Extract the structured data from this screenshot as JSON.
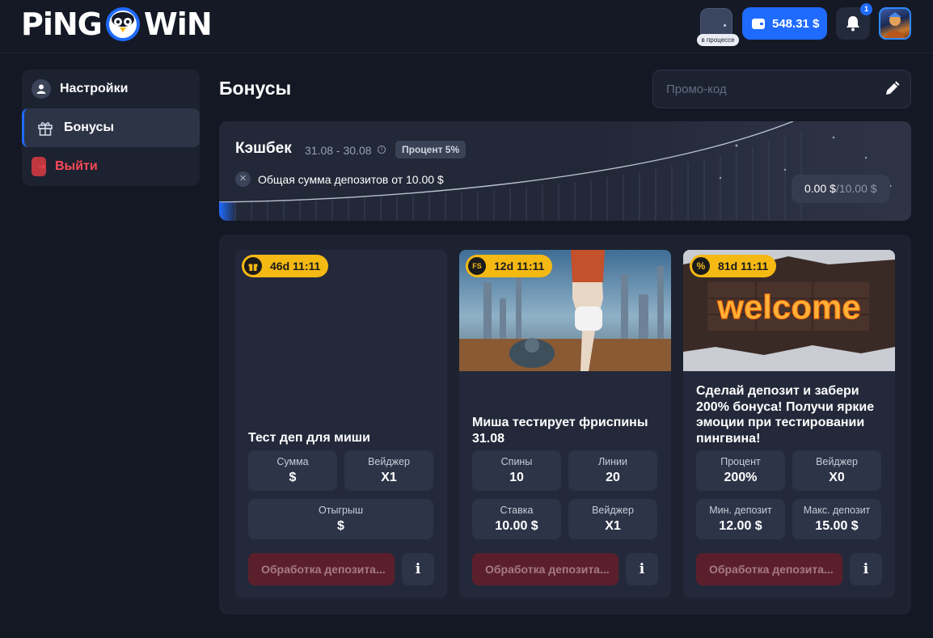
{
  "header": {
    "logo_left": "PiNG",
    "logo_right": "WiN",
    "status_label": "в процессе",
    "balance": "548.31 $",
    "notifications_count": "1"
  },
  "sidebar": {
    "items": [
      {
        "label": "Настройки",
        "icon": "user-icon"
      },
      {
        "label": "Бонусы",
        "icon": "gift-icon",
        "active": true
      },
      {
        "label": "Выйти",
        "icon": "logout-icon"
      }
    ]
  },
  "page": {
    "title": "Бонусы",
    "promo_placeholder": "Промо-код"
  },
  "cashback": {
    "title": "Кэшбек",
    "dates": "31.08 - 30.08",
    "badge": "Процент 5%",
    "condition": "Общая сумма депозитов от 10.00 $",
    "amount_current": "0.00 $",
    "amount_max": "/10.00 $"
  },
  "cards": [
    {
      "timer": "46d 11:11",
      "timer_icon": "gift-icon",
      "title": "Тест деп для миши",
      "stats": [
        {
          "label": "Сумма",
          "value": "$"
        },
        {
          "label": "Вейджер",
          "value": "X1"
        },
        {
          "label": "Отыгрыш",
          "value": "$"
        }
      ],
      "button": "Обработка депозита...",
      "info": "i"
    },
    {
      "timer": "12d 11:11",
      "timer_icon": "freespins-icon",
      "timer_icon_text": "FS",
      "title": "Миша тестирует фриспины 31.08",
      "stats": [
        {
          "label": "Спины",
          "value": "10"
        },
        {
          "label": "Линии",
          "value": "20"
        },
        {
          "label": "Ставка",
          "value": "10.00 $"
        },
        {
          "label": "Вейджер",
          "value": "X1"
        }
      ],
      "button": "Обработка депозита...",
      "info": "i"
    },
    {
      "timer": "81d 11:11",
      "timer_icon": "percent-icon",
      "timer_icon_text": "%",
      "image_text": "welcome",
      "title": "Сделай депозит и забери 200% бонуса! Получи яркие эмоции при тестировании пингвина!",
      "stats": [
        {
          "label": "Процент",
          "value": "200%"
        },
        {
          "label": "Вейджер",
          "value": "X0"
        },
        {
          "label": "Мин. депозит",
          "value": "12.00 $"
        },
        {
          "label": "Макс. депозит",
          "value": "15.00 $"
        }
      ],
      "button": "Обработка депозита...",
      "info": "i"
    }
  ],
  "colors": {
    "accent": "#1f6bff",
    "timer": "#f5b914",
    "logout": "#ff4a55"
  }
}
